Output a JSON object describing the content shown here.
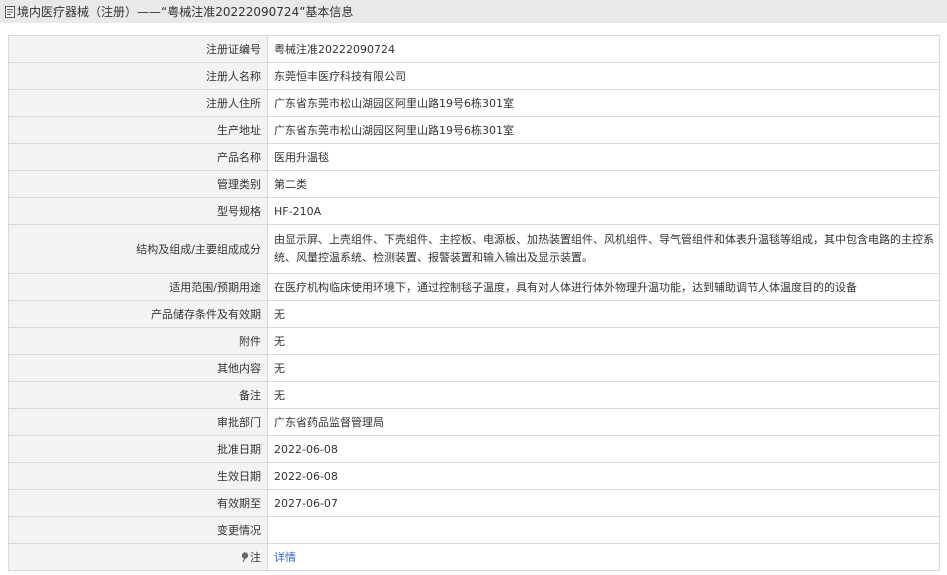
{
  "header": {
    "title": "境内医疗器械（注册）——“粤械注准20222090724”基本信息"
  },
  "rows": [
    {
      "label": "注册证编号",
      "value": "粤械注准20222090724"
    },
    {
      "label": "注册人名称",
      "value": "东莞恒丰医疗科技有限公司"
    },
    {
      "label": "注册人住所",
      "value": "广东省东莞市松山湖园区阿里山路19号6栋301室"
    },
    {
      "label": "生产地址",
      "value": "广东省东莞市松山湖园区阿里山路19号6栋301室"
    },
    {
      "label": "产品名称",
      "value": "医用升温毯"
    },
    {
      "label": "管理类别",
      "value": "第二类"
    },
    {
      "label": "型号规格",
      "value": "HF-210A"
    },
    {
      "label": "结构及组成/主要组成成分",
      "value": "由显示屏、上壳组件、下壳组件、主控板、电源板、加热装置组件、风机组件、导气管组件和体表升温毯等组成，其中包含电路的主控系统、风量控温系统、检测装置、报警装置和输入输出及显示装置。"
    },
    {
      "label": "适用范围/预期用途",
      "value": "在医疗机构临床使用环境下，通过控制毯子温度，具有对人体进行体外物理升温功能，达到辅助调节人体温度目的的设备"
    },
    {
      "label": "产品储存条件及有效期",
      "value": "无"
    },
    {
      "label": "附件",
      "value": "无"
    },
    {
      "label": "其他内容",
      "value": "无"
    },
    {
      "label": "备注",
      "value": "无"
    },
    {
      "label": "审批部门",
      "value": "广东省药品监督管理局"
    },
    {
      "label": "批准日期",
      "value": "2022-06-08"
    },
    {
      "label": "生效日期",
      "value": "2022-06-08"
    },
    {
      "label": "有效期至",
      "value": "2027-06-07"
    },
    {
      "label": "变更情况",
      "value": ""
    }
  ],
  "note": {
    "label": "注",
    "link_text": "详情",
    "icon": "pin-icon"
  },
  "colors": {
    "title_bar_bg": "#e9e9e9",
    "label_bg": "#f3f3f3",
    "border": "#d8d8d8",
    "link": "#3366cc"
  }
}
